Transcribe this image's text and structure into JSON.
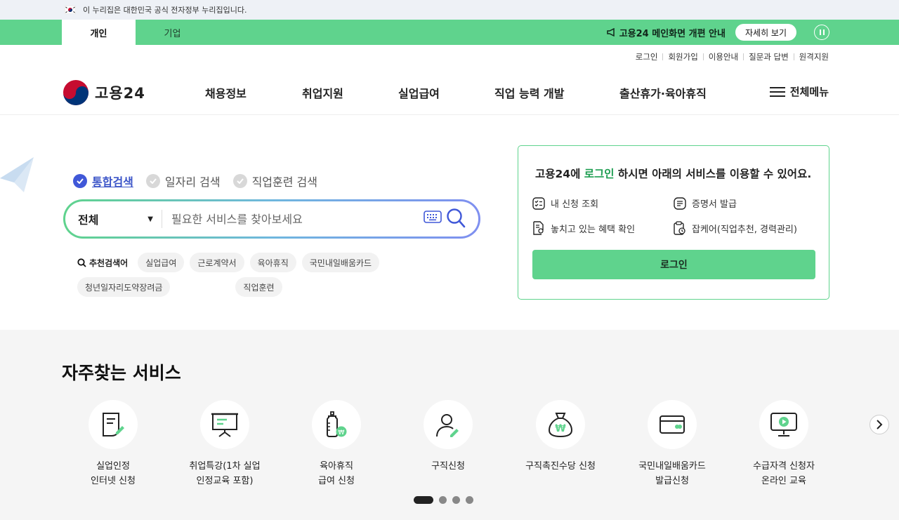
{
  "gov_banner": {
    "text": "이 누리집은 대한민국 공식 전자정부 누리집입니다."
  },
  "top_tabs": [
    {
      "label": "개인",
      "active": true
    },
    {
      "label": "기업",
      "active": false
    }
  ],
  "notice": {
    "text": "고용24 메인화면 개편 안내",
    "button": "자세히 보기"
  },
  "util_links": [
    "로그인",
    "회원가입",
    "이용안내",
    "질문과 답변",
    "원격지원"
  ],
  "logo": {
    "text": "고용24"
  },
  "gnb": [
    "채용정보",
    "취업지원",
    "실업급여",
    "직업 능력 개발",
    "출산휴가·육아휴직"
  ],
  "all_menu": "전체메뉴",
  "search": {
    "tabs": [
      {
        "label": "통합검색",
        "active": true
      },
      {
        "label": "일자리 검색",
        "active": false
      },
      {
        "label": "직업훈련 검색",
        "active": false
      }
    ],
    "category": "전체",
    "placeholder": "필요한 서비스를 찾아보세요",
    "recommend_label": "추천검색어",
    "keywords": [
      "실업급여",
      "근로계약서",
      "육아휴직",
      "국민내일배움카드",
      "청년일자리도약장려금",
      "직업훈련"
    ]
  },
  "login_card": {
    "title_pre": "고용24에 ",
    "title_hl": "로그인",
    "title_post": " 하시면 아래의 서비스를 이용할 수 있어요.",
    "items": [
      "내 신청 조회",
      "증명서 발급",
      "놓치고 있는 혜택 확인",
      "잡케어(직업추천, 경력관리)"
    ],
    "button": "로그인"
  },
  "frequent": {
    "title": "자주찾는 서비스",
    "services": [
      {
        "label": "실업인정\n인터넷 신청",
        "icon": "document-pen-icon"
      },
      {
        "label": "취업특강(1차 실업\n인정교육 포함)",
        "icon": "presentation-board-icon"
      },
      {
        "label": "육아휴직\n급여 신청",
        "icon": "baby-bottle-won-icon"
      },
      {
        "label": "구직신청",
        "icon": "person-pen-icon"
      },
      {
        "label": "구직촉진수당 신청",
        "icon": "money-bag-icon"
      },
      {
        "label": "국민내일배움카드\n발급신청",
        "icon": "card-icon"
      },
      {
        "label": "수급자격 신청자\n온라인 교육",
        "icon": "monitor-play-icon"
      }
    ],
    "page_count": 4,
    "active_page": 1
  },
  "colors": {
    "green": "#5fd38d",
    "blue": "#4058d8",
    "dark_green": "#1e9e52"
  }
}
